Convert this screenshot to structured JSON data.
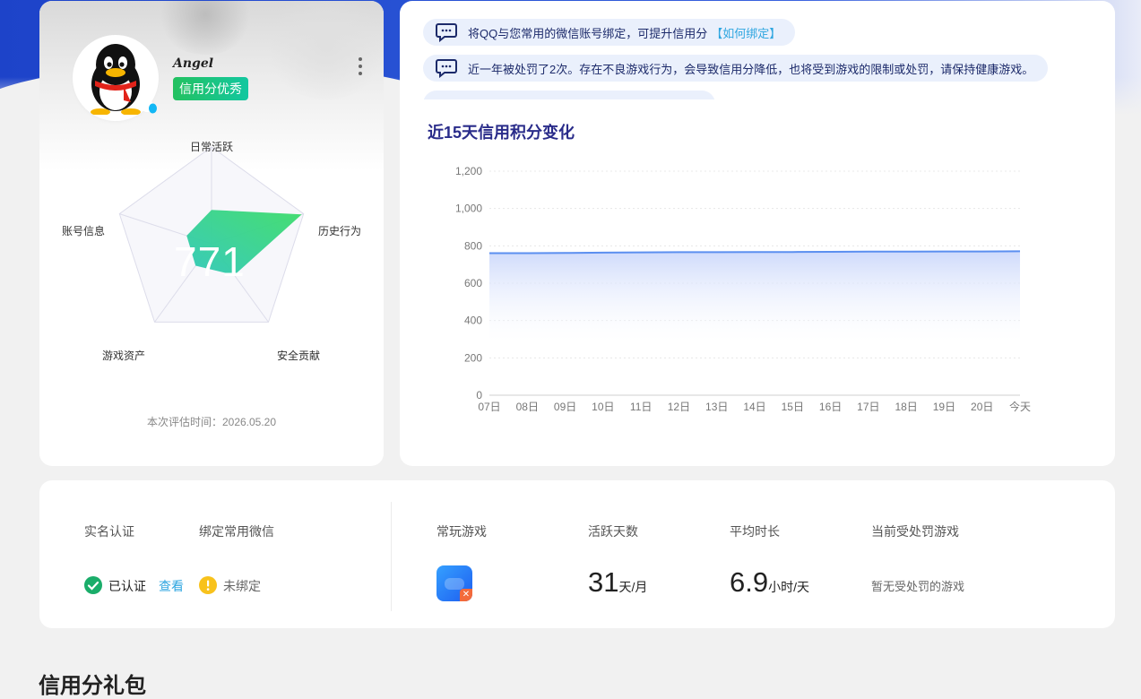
{
  "profile": {
    "username": "Angel",
    "status_badge": "信用分优秀",
    "score": "771",
    "eval_time": "本次评估时间：2026.05.20",
    "radar": {
      "labels": [
        "日常活跃",
        "历史行为",
        "安全贡献",
        "游戏资产",
        "账号信息"
      ],
      "values": [
        0.35,
        0.98,
        0.4,
        0.28,
        0.27
      ]
    }
  },
  "notices": [
    {
      "text": "将QQ与您常用的微信账号绑定，可提升信用分",
      "link": "【如何绑定】"
    },
    {
      "text": "近一年被处罚了2次。存在不良游戏行为，会导致信用分降低，也将受到游戏的限制或处罚，请保持健康游戏。",
      "link": ""
    }
  ],
  "chart_title": "近15天信用积分变化",
  "chart_data": {
    "type": "area",
    "x": [
      "07日",
      "08日",
      "09日",
      "10日",
      "11日",
      "12日",
      "13日",
      "14日",
      "15日",
      "16日",
      "17日",
      "18日",
      "19日",
      "20日",
      "今天"
    ],
    "series": [
      {
        "values": [
          761,
          761,
          762,
          764,
          765,
          766,
          766,
          767,
          767,
          768,
          769,
          769,
          770,
          770,
          771
        ]
      }
    ],
    "yticks": [
      "0",
      "200",
      "400",
      "600",
      "800",
      "1,000",
      "1,200"
    ],
    "ylim": [
      0,
      1200
    ],
    "grid": true,
    "line_color": "#5b8ff0"
  },
  "stats": {
    "real_name_head": "实名认证",
    "wechat_head": "绑定常用微信",
    "verified_text": "已认证",
    "view_link": "查看",
    "unbound_text": "未绑定",
    "games_head": "常玩游戏",
    "active_days_head": "活跃天数",
    "active_days_value": "31",
    "active_days_unit": "天/月",
    "avg_time_head": "平均时长",
    "avg_time_value": "6.9",
    "avg_time_unit": "小时/天",
    "penalty_head": "当前受处罚游戏",
    "penalty_text": "暂无受处罚的游戏"
  },
  "gift_section_title": "信用分礼包",
  "colors": {
    "brand_blue": "#1d43c9",
    "success_green": "#1aad6a",
    "warning_yellow": "#f8c21c",
    "link_blue": "#2fa6e0"
  }
}
